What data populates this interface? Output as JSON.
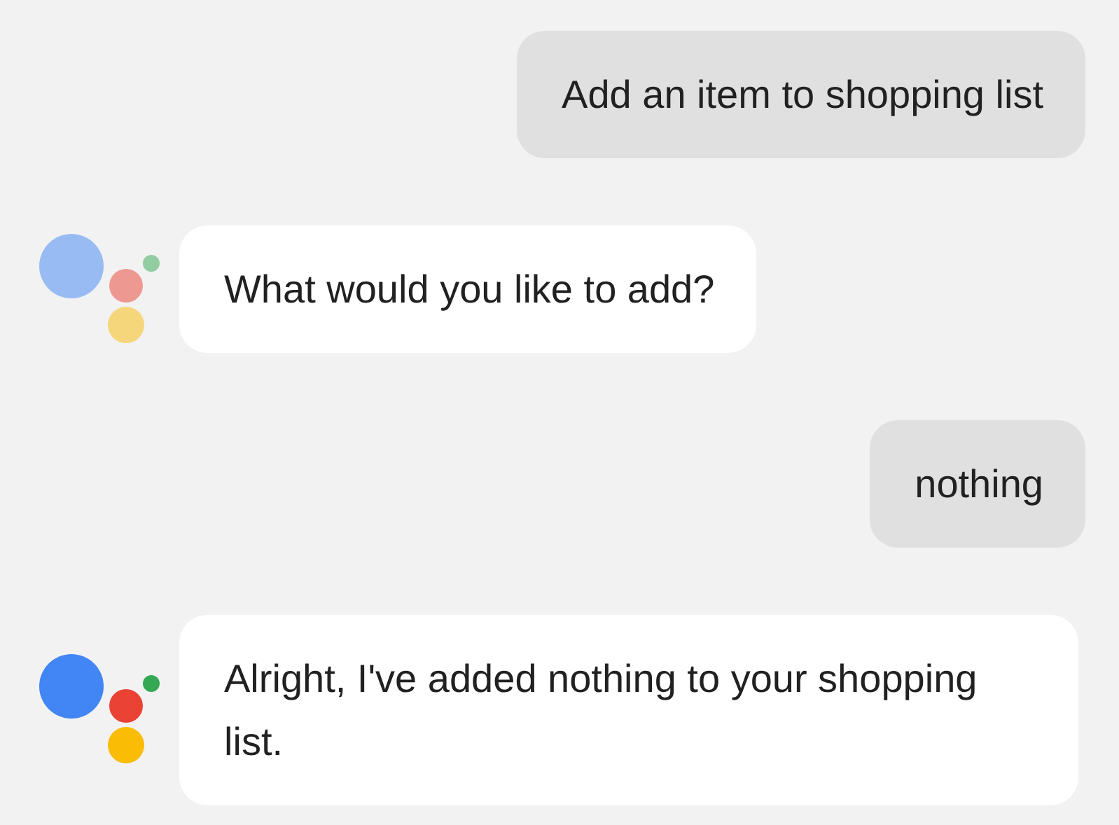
{
  "messages": [
    {
      "kind": "user",
      "text": "Add an item to shopping list"
    },
    {
      "kind": "assistant",
      "text": "What would you like to add?",
      "active": false
    },
    {
      "kind": "user",
      "text": "nothing"
    },
    {
      "kind": "assistant",
      "text": "Alright, I've added nothing to your shopping list.",
      "active": true
    }
  ]
}
